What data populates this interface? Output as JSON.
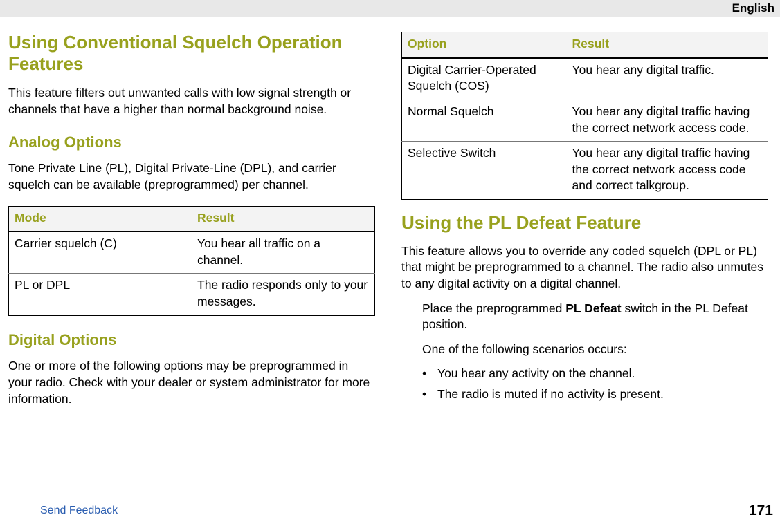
{
  "header": {
    "language": "English"
  },
  "left": {
    "h2": "Using Conventional Squelch Operation Features",
    "p1": "This feature filters out unwanted calls with low signal strength or channels that have a higher than normal background noise.",
    "h3a": "Analog Options",
    "p2": "Tone Private Line (PL), Digital Private-Line (DPL), and carrier squelch can be available (preprogrammed) per channel.",
    "table1": {
      "head": [
        "Mode",
        "Result"
      ],
      "rows": [
        [
          "Carrier squelch (C)",
          "You hear all traffic on a channel."
        ],
        [
          "PL or DPL",
          "The radio responds only to your messages."
        ]
      ]
    },
    "h3b": "Digital Options",
    "p3": "One or more of the following options may be preprogrammed in your radio. Check with your dealer or system administrator for more information."
  },
  "right": {
    "table2": {
      "head": [
        "Option",
        "Result"
      ],
      "rows": [
        [
          "Digital Carrier-Operated Squelch (COS)",
          "You hear any digital traf­fic."
        ],
        [
          "Normal Squelch",
          "You hear any digital traffic having the correct net­work access code."
        ],
        [
          "Selective Switch",
          "You hear any digital traffic having the correct net­work access code and correct talkgroup."
        ]
      ]
    },
    "h2": "Using the PL Defeat Feature",
    "p1": "This feature allows you to override any coded squelch (DPL or PL) that might be preprogrammed to a channel. The radio also unmutes to any digital activity on a digital channel.",
    "step_pre": "Place the preprogrammed ",
    "step_bold": "PL Defeat",
    "step_post": " switch in the PL Defeat position.",
    "scenarios_intro": "One of the following scenarios occurs:",
    "bullets": [
      "You hear any activity on the channel.",
      "The radio is muted if no activity is present."
    ]
  },
  "footer": {
    "send": "Send Feedback",
    "page": "171"
  }
}
